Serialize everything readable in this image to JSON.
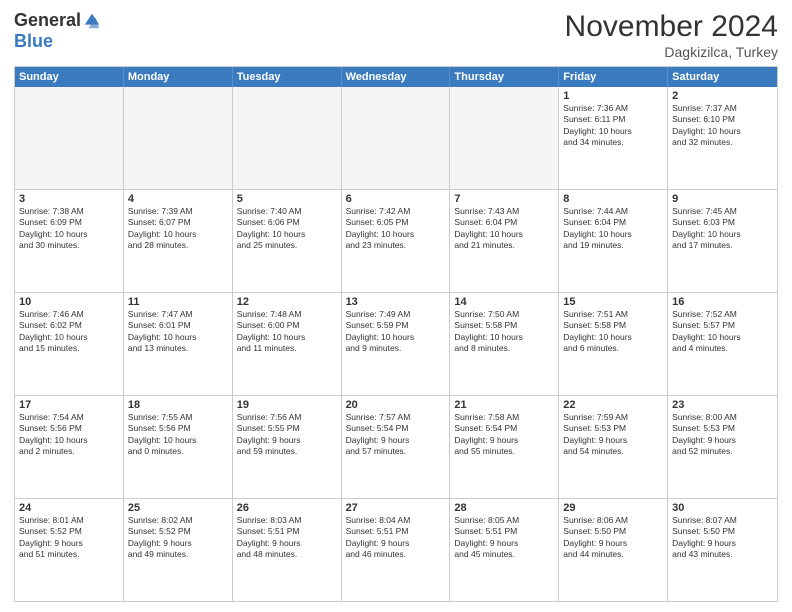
{
  "header": {
    "logo": {
      "general": "General",
      "blue": "Blue"
    },
    "title": "November 2024",
    "location": "Dagkizilca, Turkey"
  },
  "calendar": {
    "days_of_week": [
      "Sunday",
      "Monday",
      "Tuesday",
      "Wednesday",
      "Thursday",
      "Friday",
      "Saturday"
    ],
    "rows": [
      [
        {
          "day": "",
          "info": "",
          "empty": true
        },
        {
          "day": "",
          "info": "",
          "empty": true
        },
        {
          "day": "",
          "info": "",
          "empty": true
        },
        {
          "day": "",
          "info": "",
          "empty": true
        },
        {
          "day": "",
          "info": "",
          "empty": true
        },
        {
          "day": "1",
          "info": "Sunrise: 7:36 AM\nSunset: 6:11 PM\nDaylight: 10 hours\nand 34 minutes.",
          "empty": false
        },
        {
          "day": "2",
          "info": "Sunrise: 7:37 AM\nSunset: 6:10 PM\nDaylight: 10 hours\nand 32 minutes.",
          "empty": false
        }
      ],
      [
        {
          "day": "3",
          "info": "Sunrise: 7:38 AM\nSunset: 6:09 PM\nDaylight: 10 hours\nand 30 minutes.",
          "empty": false
        },
        {
          "day": "4",
          "info": "Sunrise: 7:39 AM\nSunset: 6:07 PM\nDaylight: 10 hours\nand 28 minutes.",
          "empty": false
        },
        {
          "day": "5",
          "info": "Sunrise: 7:40 AM\nSunset: 6:06 PM\nDaylight: 10 hours\nand 25 minutes.",
          "empty": false
        },
        {
          "day": "6",
          "info": "Sunrise: 7:42 AM\nSunset: 6:05 PM\nDaylight: 10 hours\nand 23 minutes.",
          "empty": false
        },
        {
          "day": "7",
          "info": "Sunrise: 7:43 AM\nSunset: 6:04 PM\nDaylight: 10 hours\nand 21 minutes.",
          "empty": false
        },
        {
          "day": "8",
          "info": "Sunrise: 7:44 AM\nSunset: 6:04 PM\nDaylight: 10 hours\nand 19 minutes.",
          "empty": false
        },
        {
          "day": "9",
          "info": "Sunrise: 7:45 AM\nSunset: 6:03 PM\nDaylight: 10 hours\nand 17 minutes.",
          "empty": false
        }
      ],
      [
        {
          "day": "10",
          "info": "Sunrise: 7:46 AM\nSunset: 6:02 PM\nDaylight: 10 hours\nand 15 minutes.",
          "empty": false
        },
        {
          "day": "11",
          "info": "Sunrise: 7:47 AM\nSunset: 6:01 PM\nDaylight: 10 hours\nand 13 minutes.",
          "empty": false
        },
        {
          "day": "12",
          "info": "Sunrise: 7:48 AM\nSunset: 6:00 PM\nDaylight: 10 hours\nand 11 minutes.",
          "empty": false
        },
        {
          "day": "13",
          "info": "Sunrise: 7:49 AM\nSunset: 5:59 PM\nDaylight: 10 hours\nand 9 minutes.",
          "empty": false
        },
        {
          "day": "14",
          "info": "Sunrise: 7:50 AM\nSunset: 5:58 PM\nDaylight: 10 hours\nand 8 minutes.",
          "empty": false
        },
        {
          "day": "15",
          "info": "Sunrise: 7:51 AM\nSunset: 5:58 PM\nDaylight: 10 hours\nand 6 minutes.",
          "empty": false
        },
        {
          "day": "16",
          "info": "Sunrise: 7:52 AM\nSunset: 5:57 PM\nDaylight: 10 hours\nand 4 minutes.",
          "empty": false
        }
      ],
      [
        {
          "day": "17",
          "info": "Sunrise: 7:54 AM\nSunset: 5:56 PM\nDaylight: 10 hours\nand 2 minutes.",
          "empty": false
        },
        {
          "day": "18",
          "info": "Sunrise: 7:55 AM\nSunset: 5:56 PM\nDaylight: 10 hours\nand 0 minutes.",
          "empty": false
        },
        {
          "day": "19",
          "info": "Sunrise: 7:56 AM\nSunset: 5:55 PM\nDaylight: 9 hours\nand 59 minutes.",
          "empty": false
        },
        {
          "day": "20",
          "info": "Sunrise: 7:57 AM\nSunset: 5:54 PM\nDaylight: 9 hours\nand 57 minutes.",
          "empty": false
        },
        {
          "day": "21",
          "info": "Sunrise: 7:58 AM\nSunset: 5:54 PM\nDaylight: 9 hours\nand 55 minutes.",
          "empty": false
        },
        {
          "day": "22",
          "info": "Sunrise: 7:59 AM\nSunset: 5:53 PM\nDaylight: 9 hours\nand 54 minutes.",
          "empty": false
        },
        {
          "day": "23",
          "info": "Sunrise: 8:00 AM\nSunset: 5:53 PM\nDaylight: 9 hours\nand 52 minutes.",
          "empty": false
        }
      ],
      [
        {
          "day": "24",
          "info": "Sunrise: 8:01 AM\nSunset: 5:52 PM\nDaylight: 9 hours\nand 51 minutes.",
          "empty": false
        },
        {
          "day": "25",
          "info": "Sunrise: 8:02 AM\nSunset: 5:52 PM\nDaylight: 9 hours\nand 49 minutes.",
          "empty": false
        },
        {
          "day": "26",
          "info": "Sunrise: 8:03 AM\nSunset: 5:51 PM\nDaylight: 9 hours\nand 48 minutes.",
          "empty": false
        },
        {
          "day": "27",
          "info": "Sunrise: 8:04 AM\nSunset: 5:51 PM\nDaylight: 9 hours\nand 46 minutes.",
          "empty": false
        },
        {
          "day": "28",
          "info": "Sunrise: 8:05 AM\nSunset: 5:51 PM\nDaylight: 9 hours\nand 45 minutes.",
          "empty": false
        },
        {
          "day": "29",
          "info": "Sunrise: 8:06 AM\nSunset: 5:50 PM\nDaylight: 9 hours\nand 44 minutes.",
          "empty": false
        },
        {
          "day": "30",
          "info": "Sunrise: 8:07 AM\nSunset: 5:50 PM\nDaylight: 9 hours\nand 43 minutes.",
          "empty": false
        }
      ]
    ]
  }
}
